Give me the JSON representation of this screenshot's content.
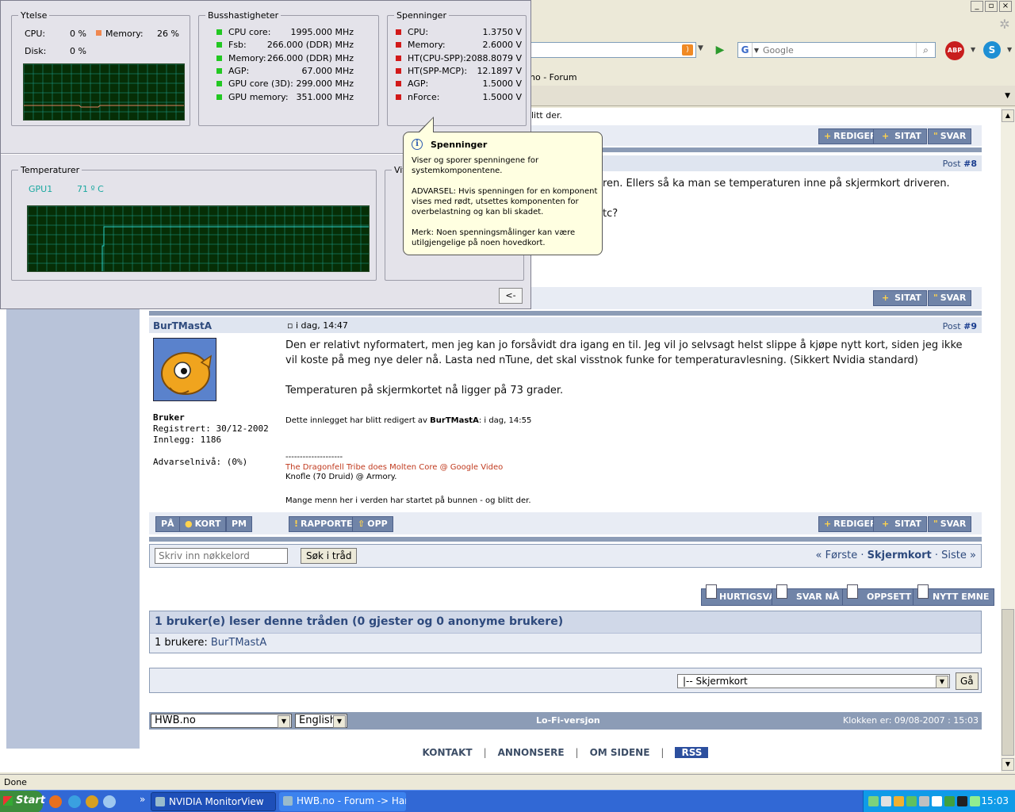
{
  "browser": {
    "tab_title_fragment": "no - Forum",
    "search_placeholder": "Google",
    "status": "Done"
  },
  "nvidia": {
    "ytelse": {
      "title": "Ytelse",
      "cpu_label": "CPU:",
      "cpu_value": "0 %",
      "mem_label": "Memory:",
      "mem_value": "26 %",
      "disk_label": "Disk:",
      "disk_value": "0 %"
    },
    "buss": {
      "title": "Busshastigheter",
      "rows": [
        {
          "label": "CPU core:",
          "value": "1995.000 MHz"
        },
        {
          "label": "Fsb:",
          "value": "266.000  (DDR) MHz"
        },
        {
          "label": "Memory:",
          "value": "266.000  (DDR) MHz"
        },
        {
          "label": "AGP:",
          "value": "67.000  MHz"
        },
        {
          "label": "GPU core (3D):",
          "value": "299.000 MHz"
        },
        {
          "label": "GPU memory:",
          "value": "351.000 MHz"
        }
      ]
    },
    "spenning": {
      "title": "Spenninger",
      "rows": [
        {
          "label": "CPU:",
          "value": "1.3750 V"
        },
        {
          "label": "Memory:",
          "value": "2.6000 V"
        },
        {
          "label": "HT(CPU-SPP):",
          "value": "2088.8079 V"
        },
        {
          "label": "HT(SPP-MCP):",
          "value": "12.1897 V"
        },
        {
          "label": "AGP:",
          "value": "1.5000 V"
        },
        {
          "label": "nForce:",
          "value": "1.5000 V"
        }
      ]
    },
    "temp": {
      "title": "Temperaturer",
      "gpu_label": "GPU1",
      "gpu_value": "71 º C"
    },
    "fan": {
      "title": "Vif"
    },
    "collapse_label": "<-",
    "colors": {
      "scope_bg": "#062e06",
      "grid": "#1f9a8a",
      "temp_line": "#2ad0c8",
      "mem_line": "#e08060"
    }
  },
  "tooltip": {
    "title": "Spenninger",
    "body": "Viser og sporer spenningene for systemkomponentene.\n\nADVARSEL: Hvis spenningen for en komponent vises med rødt, utsettes komponenten for overbelastning og kan bli skadet.\n\nMerk: Noen spenningsmålinger kan være utilgjengelige på noen hovedkort."
  },
  "forum": {
    "post7_tail": "litt der.",
    "buttons": {
      "rediger": "REDIGER",
      "sitat": "SITAT",
      "svar": "SVAR",
      "rapporter": "RAPPORTER",
      "opp": "OPP",
      "paa": "PÅ",
      "kort": "KORT",
      "pm": "PM"
    },
    "post8": {
      "num_label": "Post",
      "num": "#8",
      "line1": "ren. Ellers så ka man se temperaturen inne på skjermkort driveren.",
      "line2": "tc?"
    },
    "post9": {
      "author": "BurTMastA",
      "date": "i dag, 14:47",
      "num_label": "Post",
      "num": "#9",
      "rank": "Bruker",
      "registered": "Registrert: 30/12-2002",
      "posts": "Innlegg: 1186",
      "warn": "Advarselnivå: (0%)",
      "text1": "Den er relativt nyformatert, men jeg kan jo forsåvidt dra igang en til. Jeg vil jo selvsagt helst slippe å kjøpe nytt kort, siden jeg ikke vil koste på meg nye deler nå. Lasta ned nTune, det skal visstnok funke for temperaturavlesning. (Sikkert Nvidia standard)",
      "text2": "Temperaturen på skjermkortet nå ligger på 73 grader.",
      "edited_prefix": "Dette innlegget har blitt redigert av",
      "edited_by": "BurTMastA",
      "edited_suffix": ": i dag, 14:55",
      "sig_sep": "--------------------",
      "sig_link": "The Dragonfell Tribe does Molten Core @ Google Video",
      "sig_line2": "Knofle (70 Druid) @ Armory.",
      "sig_line3": "Mange menn her i verden har startet på bunnen - og blitt der."
    },
    "thread": {
      "keyword_placeholder": "Skriv inn nøkkelord",
      "search_btn": "Søk i tråd",
      "first": "« Første",
      "current": "Skjermkort",
      "last": "Siste »",
      "sep": "·"
    },
    "actions": [
      "HURTIGSVAR",
      "SVAR NÅ",
      "OPPSETT",
      "NYTT EMNE"
    ],
    "readers": {
      "head": "1 bruker(e) leser denne tråden (0 gjester og 0 anonyme brukere)",
      "label": "1 brukere:",
      "user": "BurTMastA"
    },
    "jump": {
      "selected": "|-- Skjermkort",
      "go": "Gå"
    },
    "footer": {
      "site": "HWB.no",
      "lang": "English",
      "lofi": "Lo-Fi-versjon",
      "clock": "Klokken er: 09/08-2007 : 15:03"
    },
    "links": {
      "kontakt": "KONTAKT",
      "annonsere": "ANNONSERE",
      "om": "OM SIDENE",
      "rss": "RSS",
      "sep": "|"
    }
  },
  "taskbar": {
    "start": "Start",
    "tasks": [
      "NVIDIA MonitorView",
      "HWB.no - Forum -> Har ..."
    ],
    "time": "15:03"
  }
}
